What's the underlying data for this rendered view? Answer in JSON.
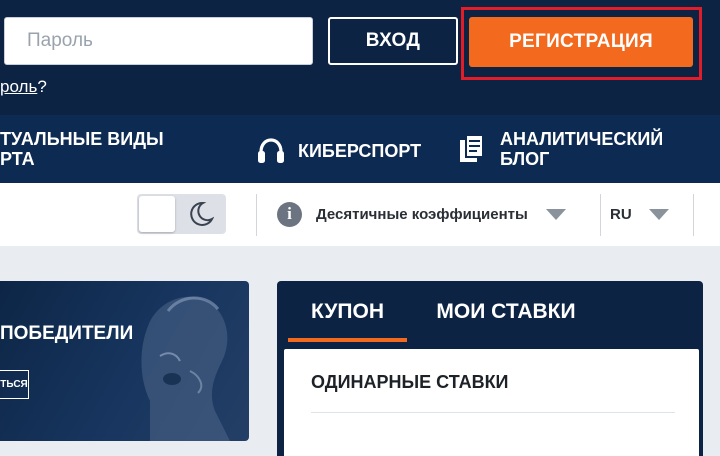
{
  "header": {
    "password_placeholder": "Пароль",
    "login_label": "ВХОД",
    "register_label": "РЕГИСТРАЦИЯ",
    "forgot_visible": "роль",
    "forgot_suffix": "?"
  },
  "nav": {
    "items": [
      {
        "label": "ТУАЛЬНЫЕ ВИДЫ\nРТА",
        "icon": "none"
      },
      {
        "label": "КИБЕРСПОРТ",
        "icon": "headset-icon"
      },
      {
        "label": "АНАЛИТИЧЕСКИЙ\nБЛОГ",
        "icon": "documents-icon"
      }
    ]
  },
  "toolbar": {
    "theme_icon": "moon-icon",
    "odds_info_glyph": "i",
    "odds_label": "Десятичные коэффициенты",
    "lang_label": "RU"
  },
  "banner": {
    "title": "ПОБЕДИТЕЛИ",
    "button_label": "ТЬСЯ"
  },
  "coupon": {
    "tabs": [
      {
        "label": "КУПОН",
        "active": true
      },
      {
        "label": "МОИ СТАВКИ",
        "active": false
      }
    ],
    "section_title": "ОДИНАРНЫЕ СТАВКИ"
  },
  "colors": {
    "header_bg": "#0c2344",
    "nav_bg": "#0d2a52",
    "accent": "#f36a1e",
    "highlight_red": "#e11d2a",
    "page_bg": "#e9ecf1"
  }
}
